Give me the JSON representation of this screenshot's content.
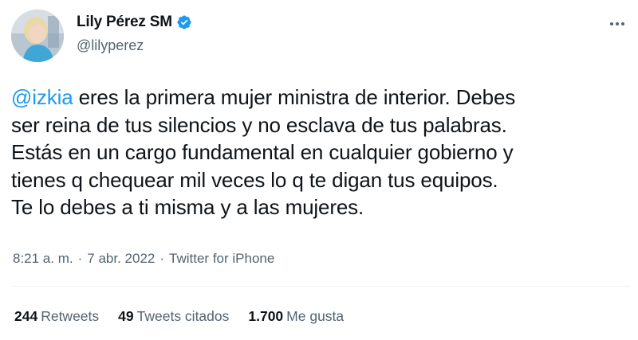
{
  "author": {
    "display_name": "Lily Pérez SM",
    "handle": "@lilyperez",
    "verified": true
  },
  "tweet": {
    "mention": "@izkia",
    "line1_rest": " eres la primera mujer ministra de interior. Debes",
    "line2": "ser reina de tus silencios y no esclava de tus palabras.",
    "line3": "Estás en un cargo fundamental en cualquier gobierno y",
    "line4": "tienes q chequear mil veces lo q te digan tus equipos.",
    "line5": "Te lo debes a ti misma y a las mujeres."
  },
  "meta": {
    "time": "8:21 a. m.",
    "separator": "·",
    "date": "7 abr. 2022",
    "source": "Twitter for iPhone"
  },
  "stats": {
    "retweets_count": "244",
    "retweets_label": "Retweets",
    "quotes_count": "49",
    "quotes_label": "Tweets citados",
    "likes_count": "1.700",
    "likes_label": "Me gusta"
  },
  "icons": {
    "verified": "verified-badge-icon",
    "more": "more-options-icon"
  },
  "colors": {
    "accent": "#1d9bf0",
    "text": "#0f1419",
    "secondary": "#536471",
    "divider": "#eff3f4"
  }
}
